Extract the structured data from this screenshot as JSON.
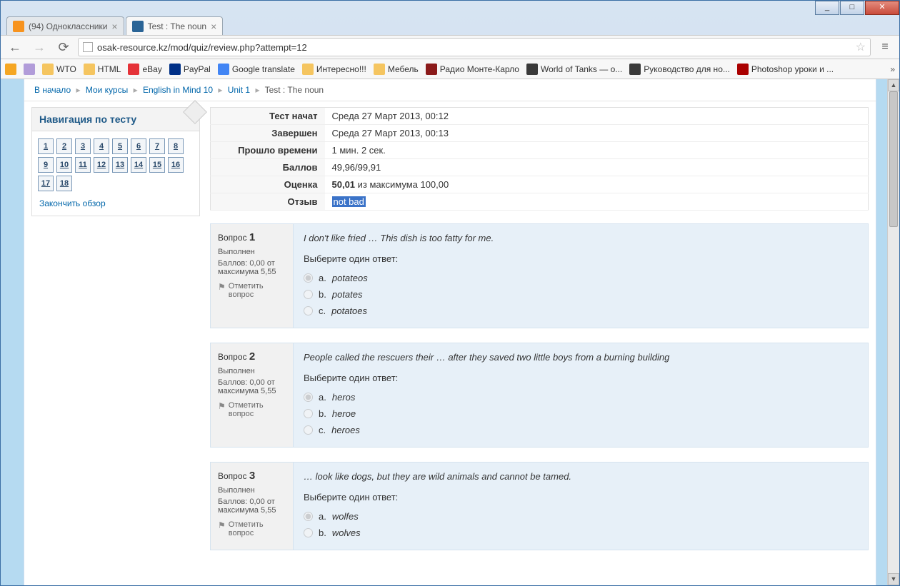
{
  "window": {
    "min": "_",
    "max": "□",
    "close": "✕"
  },
  "tabs": [
    {
      "title": "(94) Одноклассники",
      "active": false
    },
    {
      "title": "Test : The noun",
      "active": true
    }
  ],
  "nav": {
    "url": "osak-resource.kz/mod/quiz/review.php?attempt=12"
  },
  "bookmarks": {
    "b1": "WTO",
    "b2": "HTML",
    "b3": "eBay",
    "b4": "PayPal",
    "b5": "Google translate",
    "b6": "Интересно!!!",
    "b7": "Мебель",
    "b8": "Радио Монте-Карло",
    "b9": "World of Tanks — о...",
    "b10": "Руководство для но...",
    "b11": "Photoshop уроки и ...",
    "more": "»"
  },
  "breadcrumb": {
    "items": [
      "В начало",
      "Мои курсы",
      "English in Mind 10",
      "Unit 1",
      "Test : The noun"
    ]
  },
  "side": {
    "title": "Навигация по тесту",
    "nums": [
      "1",
      "2",
      "3",
      "4",
      "5",
      "6",
      "7",
      "8",
      "9",
      "10",
      "11",
      "12",
      "13",
      "14",
      "15",
      "16",
      "17",
      "18"
    ],
    "finish": "Закончить обзор"
  },
  "summary": {
    "rows": [
      {
        "k": "Тест начат",
        "v": "Среда 27 Март 2013, 00:12"
      },
      {
        "k": "Завершен",
        "v": "Среда 27 Март 2013, 00:13"
      },
      {
        "k": "Прошло времени",
        "v": "1 мин. 2 сек."
      },
      {
        "k": "Баллов",
        "v": "49,96/99,91"
      },
      {
        "k": "Оценка",
        "v_html": "<b>50,01</b> из максимума 100,00"
      },
      {
        "k": "Отзыв",
        "v_html": "<span class='review-sel'>not bad</span>"
      }
    ]
  },
  "questions": [
    {
      "num": "1",
      "state": "Выполнен",
      "mark": "Баллов: 0,00 от максимума 5,55",
      "flag": "Отметить вопрос",
      "text": "I don't like fried … This dish is too fatty for me.",
      "prompt": "Выберите один ответ:",
      "opts": [
        {
          "l": "a.",
          "t": "potateos",
          "sel": true
        },
        {
          "l": "b.",
          "t": "potates",
          "sel": false
        },
        {
          "l": "c.",
          "t": "potatoes",
          "sel": false
        }
      ]
    },
    {
      "num": "2",
      "state": "Выполнен",
      "mark": "Баллов: 0,00 от максимума 5,55",
      "flag": "Отметить вопрос",
      "text": "People called the rescuers their … after they saved two little boys from a burning building",
      "prompt": "Выберите один ответ:",
      "opts": [
        {
          "l": "a.",
          "t": "heros",
          "sel": true
        },
        {
          "l": "b.",
          "t": "heroe",
          "sel": false
        },
        {
          "l": "c.",
          "t": "heroes",
          "sel": false
        }
      ]
    },
    {
      "num": "3",
      "state": "Выполнен",
      "mark": "Баллов: 0,00 от максимума 5,55",
      "flag": "Отметить вопрос",
      "text": "… look like dogs, but they are wild animals and cannot be tamed.",
      "prompt": "Выберите один ответ:",
      "opts": [
        {
          "l": "a.",
          "t": "wolfes",
          "sel": true
        },
        {
          "l": "b.",
          "t": "wolves",
          "sel": false
        }
      ]
    }
  ],
  "qlabel": "Вопрос"
}
